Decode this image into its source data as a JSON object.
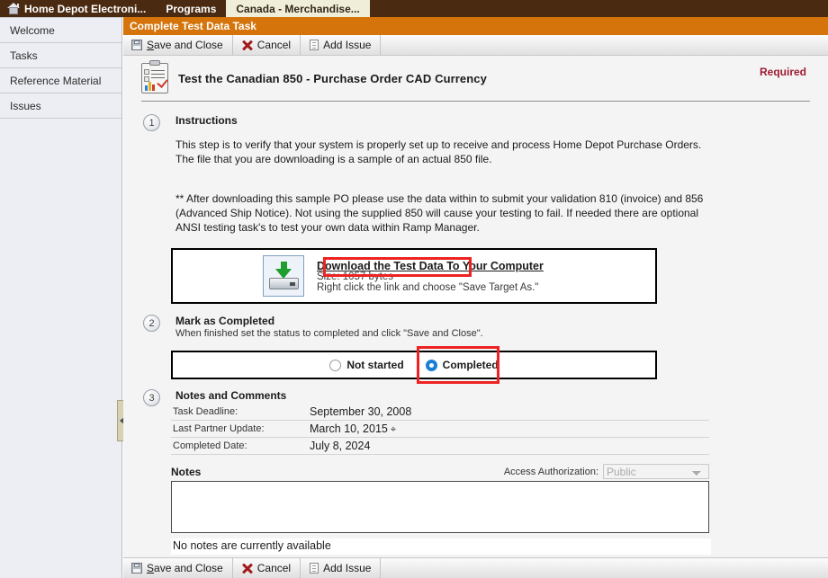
{
  "topbar": {
    "items": [
      {
        "label": "Home Depot Electroni...",
        "icon": "home-icon",
        "active": false
      },
      {
        "label": "Programs",
        "active": false
      },
      {
        "label": "Canada - Merchandise...",
        "active": true
      }
    ]
  },
  "sidebar": {
    "items": [
      {
        "label": "Welcome"
      },
      {
        "label": "Tasks"
      },
      {
        "label": "Reference Material"
      },
      {
        "label": "Issues"
      }
    ]
  },
  "page": {
    "header_title": "Complete Test Data Task",
    "task_title": "Test the Canadian 850 - Purchase Order CAD Currency",
    "required_badge": "Required"
  },
  "toolbar": {
    "save_label": "Save and Close",
    "save_underline": "S",
    "save_rest": "ave and Close",
    "cancel_label": "Cancel",
    "add_issue_label": "Add Issue"
  },
  "steps": {
    "one": {
      "number": "1",
      "title": "Instructions",
      "paragraph1": "This step is to verify that your system is properly set up to receive and process Home Depot Purchase Orders.  The file that you are downloading is a sample of an actual 850 file.",
      "paragraph2": "** After downloading this sample PO please use the data within to submit your validation 810 (invoice) and 856 (Advanced Ship Notice). Not using the supplied 850 will cause your testing to fail. If needed there are optional ANSI testing task's to test your own data within Ramp Manager."
    },
    "two": {
      "number": "2",
      "title": "Mark as Completed",
      "subtitle": "When finished set the status to completed and click \"Save and Close\"."
    },
    "three": {
      "number": "3",
      "title": "Notes and Comments"
    }
  },
  "download": {
    "link_label": "Download the Test Data To Your Computer",
    "size_text": "Size: 1057 bytes",
    "hint_text": "Right click the link and choose \"Save Target As.\"",
    "icon": "download-to-disk-icon",
    "highlight_color": "#ee2222"
  },
  "status": {
    "options": [
      {
        "label": "Not started",
        "selected": false
      },
      {
        "label": "Completed",
        "selected": true
      }
    ],
    "highlight_color": "#ee2222",
    "selected_color": "#1a7fd4"
  },
  "notes_fields": [
    {
      "label": "Task Deadline:",
      "value": "September 30, 2008"
    },
    {
      "label": "Last Partner Update:",
      "value": "March 10, 2015"
    },
    {
      "label": "Completed Date:",
      "value": "July 8, 2024"
    }
  ],
  "notes": {
    "label": "Notes",
    "access_authorization_label": "Access Authorization:",
    "access_authorization_value": "Public",
    "access_authorization_options": [
      "Public"
    ],
    "textarea_value": "",
    "empty_message": "No notes are currently available"
  },
  "colors": {
    "topbar_bg": "#4a2a10",
    "active_tab_bg": "#f0eed9",
    "page_header_bg": "#d4740a",
    "required_text": "#9e1b32",
    "sidebar_bg": "#eceef3"
  }
}
